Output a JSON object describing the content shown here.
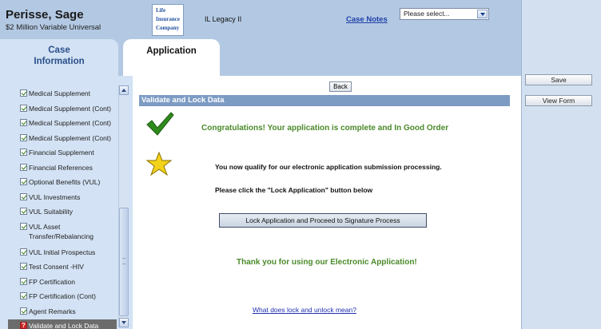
{
  "header": {
    "client_name": "Perisse, Sage",
    "client_sub": "$2 Million Variable Universal",
    "company_logo_lines": [
      "Life",
      "Insurance",
      "Company"
    ],
    "product_name": "IL Legacy II",
    "case_notes_link": "Case Notes",
    "select_value": "Please select..."
  },
  "tabs": [
    {
      "label": "Case\nInformation",
      "active": false
    },
    {
      "label": "Application",
      "active": true
    }
  ],
  "right_panel": {
    "save_label": "Save",
    "view_form_label": "View Form"
  },
  "sidebar": {
    "items": [
      {
        "label": "Medical Supplement",
        "status": "complete"
      },
      {
        "label": "Medical Supplement (Cont)",
        "status": "complete"
      },
      {
        "label": "Medical Supplement (Cont)",
        "status": "complete"
      },
      {
        "label": "Medical Supplement (Cont)",
        "status": "complete"
      },
      {
        "label": "Financial Supplement",
        "status": "complete"
      },
      {
        "label": "Financial References",
        "status": "complete"
      },
      {
        "label": "Optional Benefits (VUL)",
        "status": "complete"
      },
      {
        "label": "VUL Investments",
        "status": "complete"
      },
      {
        "label": "VUL Suitability",
        "status": "complete"
      },
      {
        "label": "VUL Asset Transfer/Rebalancing",
        "status": "complete"
      },
      {
        "label": "VUL Initial Prospectus",
        "status": "complete"
      },
      {
        "label": "Test Consent -HIV",
        "status": "complete"
      },
      {
        "label": "FP Certification",
        "status": "complete"
      },
      {
        "label": "FP Certification (Cont)",
        "status": "complete"
      },
      {
        "label": "Agent Remarks",
        "status": "complete"
      },
      {
        "label": "Validate and Lock Data",
        "status": "current"
      }
    ]
  },
  "main": {
    "back_label": "Back",
    "section_title": "Validate and Lock Data",
    "congrats_text": "Congratulations! Your application is complete and In Good Order",
    "qualify_text": "You now qualify for our electronic application submission processing.",
    "click_text": "Please click the \"Lock Application\" button below",
    "lock_button_label": "Lock Application and Proceed to Signature Process",
    "thanks_text": "Thank you for using our Electronic Application!",
    "lock_link_text": "What does lock and unlock mean?"
  },
  "colors": {
    "header_bg": "#b3c9e3",
    "sidebar_bg": "#d3e2f4",
    "section_bar": "#7d9cc4",
    "success_green": "#4a8a2a",
    "link_blue": "#2040a8"
  },
  "icons": [
    "check-mark-icon",
    "star-icon",
    "checkbox-checked-icon",
    "question-mark-icon",
    "chevron-down-icon",
    "chevron-up-icon"
  ]
}
